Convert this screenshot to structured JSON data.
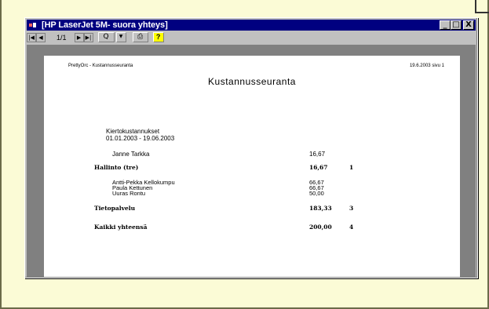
{
  "window": {
    "title": "[HP LaserJet 5M- suora yhteys]",
    "minimize": "_",
    "maximize": "□",
    "close": "X"
  },
  "toolbar": {
    "page_indicator": "1/1",
    "zoom_icon": "Q",
    "dropdown": "▼",
    "print_icon": "print-icon",
    "help_label": "?"
  },
  "report": {
    "header_left": "PrettyOrc - Kustannusseuranta",
    "header_right": "19.6.2003  sivu 1",
    "title": "Kustannusseuranta",
    "subtitle_line1": "Kiertokustannukset",
    "subtitle_line2": "01.01.2003 - 19.06.2003",
    "groups": [
      {
        "members": [
          {
            "name": "Janne Tarkka",
            "amount": "16,67"
          }
        ],
        "group_name": "Hallinto (tre)",
        "group_total": "16,67",
        "group_count": "1"
      },
      {
        "members": [
          {
            "name": "Antti-Pekka Kellokumpu",
            "amount": "66,67"
          },
          {
            "name": "Paula Kettunen",
            "amount": "66,67"
          },
          {
            "name": "Uuras Rontu",
            "amount": "50,00"
          }
        ],
        "group_name": "Tietopalvelu",
        "group_total": "183,33",
        "group_count": "3"
      }
    ],
    "grand_total_label": "Kaikki yhteensä",
    "grand_total": "200,00",
    "grand_count": "4"
  }
}
